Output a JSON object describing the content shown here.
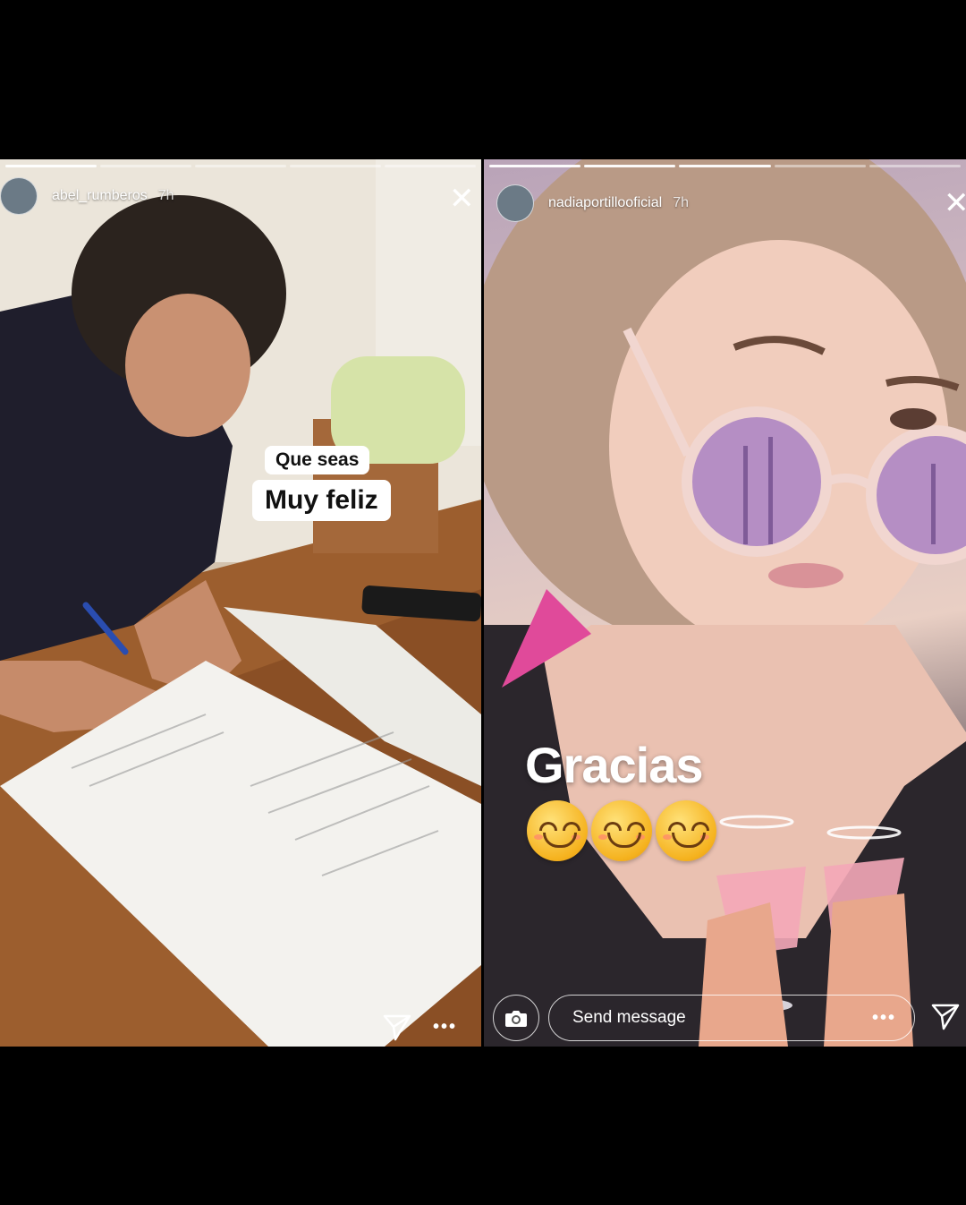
{
  "left_story": {
    "username": "abel_rumberos",
    "time": "7h",
    "progress": {
      "total": 5,
      "completed": 1
    },
    "text_sticker": {
      "line1": "Que seas",
      "line2": "Muy feliz"
    },
    "icons": {
      "close": "close-icon",
      "share": "paper-plane-icon",
      "more": "more-dots-icon"
    },
    "more_label": "•••"
  },
  "right_story": {
    "username": "nadiaportillooficial",
    "time": "7h",
    "progress": {
      "total": 5,
      "completed": 3
    },
    "caption": "Gracias",
    "emojis": [
      "smiling-face",
      "smiling-face",
      "smiling-face"
    ],
    "reply": {
      "placeholder": "Send message"
    },
    "icons": {
      "close": "close-icon",
      "camera": "camera-icon",
      "share": "paper-plane-icon",
      "more": "more-dots-icon"
    },
    "more_label": "•••"
  },
  "colors": {
    "background": "#000000",
    "overlay_text": "#ffffff"
  }
}
